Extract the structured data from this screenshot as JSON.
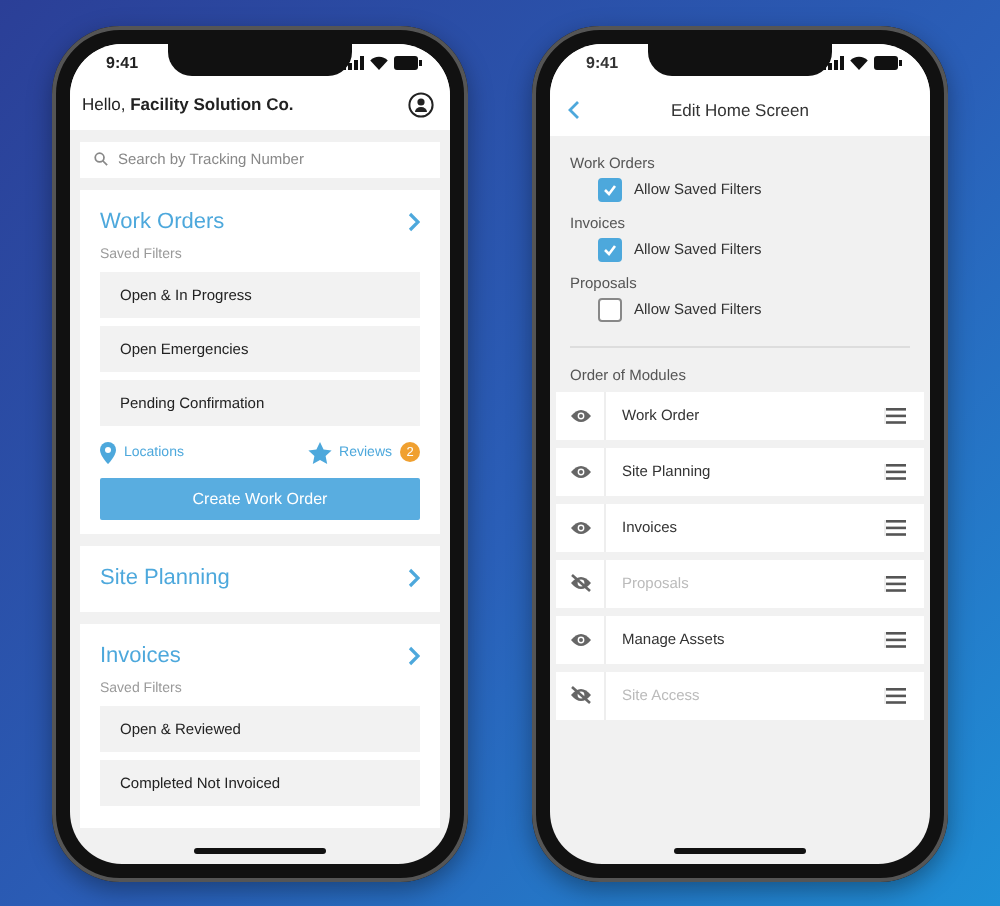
{
  "home": {
    "status_time": "9:41",
    "greeting": "Hello, **Facility Solution Co.**",
    "search": {
      "placeholder": "Search by Tracking Number"
    },
    "modules": [
      {
        "title": "Work Orders",
        "filters_label": "Saved Filters",
        "filters": [
          "Open & In Progress",
          "Open Emergencies",
          "Pending Confirmation"
        ],
        "links": [
          {
            "label": "Locations",
            "kind": "pin"
          },
          {
            "label": "Reviews",
            "kind": "star",
            "badge": "2"
          }
        ],
        "button": "Create Work Order"
      },
      {
        "title": "Site Planning"
      },
      {
        "title": "Invoices",
        "filters_label": "Saved Filters",
        "filters": [
          "Open & Reviewed",
          "Completed Not Invoiced"
        ]
      }
    ]
  },
  "edit": {
    "status_time": "9:41",
    "title": "Edit Home Screen",
    "settings": [
      {
        "group": "Work Orders",
        "label": "Allow Saved Filters",
        "checked": true
      },
      {
        "group": "Invoices",
        "label": "Allow Saved Filters",
        "checked": true
      },
      {
        "group": "Proposals",
        "label": "Allow Saved Filters",
        "checked": false
      }
    ],
    "order_heading": "Order of Modules",
    "modules": [
      {
        "name": "Work Order",
        "visible": true
      },
      {
        "name": "Site Planning",
        "visible": true
      },
      {
        "name": "Invoices",
        "visible": true
      },
      {
        "name": "Proposals",
        "visible": false
      },
      {
        "name": "Manage Assets",
        "visible": true
      },
      {
        "name": "Site Access",
        "visible": false
      }
    ]
  }
}
